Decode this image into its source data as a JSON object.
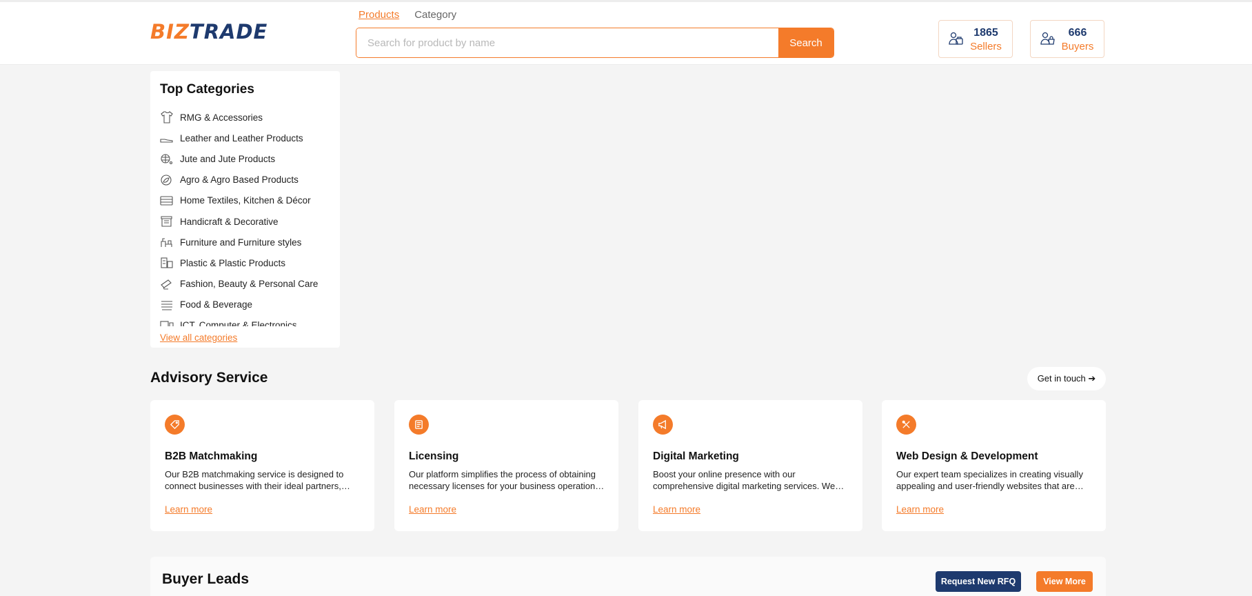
{
  "header": {
    "logo_left": "BIZ",
    "logo_right": "TRADE",
    "tabs": [
      {
        "label": "Products",
        "active": true
      },
      {
        "label": "Category",
        "active": false
      }
    ],
    "search": {
      "placeholder": "Search for product by name",
      "value": "",
      "button_label": "Search"
    },
    "stats": [
      {
        "value": "1865",
        "label": "Sellers",
        "icon": "sellers-icon"
      },
      {
        "value": "666",
        "label": "Buyers",
        "icon": "buyers-icon"
      }
    ]
  },
  "categories": {
    "title": "Top Categories",
    "items": [
      {
        "label": "RMG & Accessories",
        "icon": "shirt-icon"
      },
      {
        "label": "Leather and Leather Products",
        "icon": "shoe-icon"
      },
      {
        "label": "Jute and Jute Products",
        "icon": "jute-icon"
      },
      {
        "label": "Agro & Agro Based Products",
        "icon": "agro-icon"
      },
      {
        "label": "Home Textiles, Kitchen & Décor",
        "icon": "textile-icon"
      },
      {
        "label": "Handicraft & Decorative",
        "icon": "handicraft-icon"
      },
      {
        "label": "Furniture and Furniture styles",
        "icon": "furniture-icon"
      },
      {
        "label": "Plastic & Plastic Products",
        "icon": "plastic-icon"
      },
      {
        "label": "Fashion, Beauty & Personal Care",
        "icon": "beauty-icon"
      },
      {
        "label": "Food & Beverage",
        "icon": "food-icon"
      },
      {
        "label": "ICT, Computer & Electronics",
        "icon": "computer-icon"
      }
    ],
    "view_all": "View all categories"
  },
  "advisory": {
    "title": "Advisory Service",
    "cta": "Get in touch ➔",
    "cards": [
      {
        "title": "B2B Matchmaking",
        "description": "Our B2B matchmaking service is designed to connect businesses with their ideal partners, suppliers and buyers.",
        "link": "Learn more",
        "icon": "tag-icon"
      },
      {
        "title": "Licensing",
        "description": "Our platform simplifies the process of obtaining necessary licenses for your business operations and trade.",
        "link": "Learn more",
        "icon": "document-icon"
      },
      {
        "title": "Digital Marketing",
        "description": "Boost your online presence with our comprehensive digital marketing services. We help you reach more buyers.",
        "link": "Learn more",
        "icon": "megaphone-icon"
      },
      {
        "title": "Web Design & Development",
        "description": "Our expert team specializes in creating visually appealing and user-friendly websites that are responsive.",
        "link": "Learn more",
        "icon": "design-tools-icon"
      }
    ]
  },
  "buyer_leads": {
    "title": "Buyer Leads",
    "rfq_button": "Request New RFQ",
    "view_more_button": "View More"
  },
  "colors": {
    "accent": "#f47b2a",
    "brand_navy": "#1e3a6e",
    "background": "#f4f4f4"
  }
}
